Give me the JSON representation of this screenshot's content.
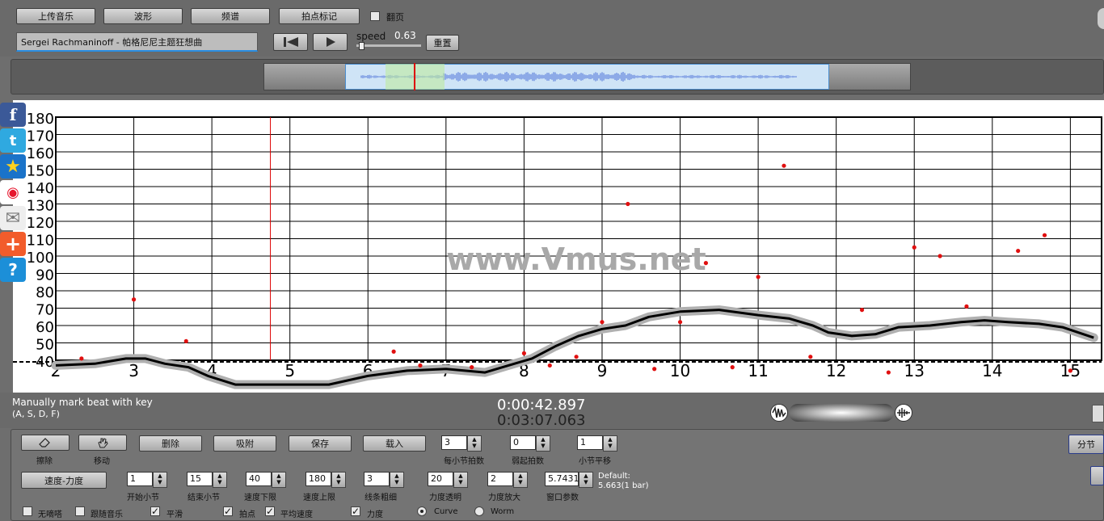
{
  "toolbar": {
    "upload_label": "上传音乐",
    "waveform_label": "波形",
    "spectrum_label": "频谱",
    "beat_label": "拍点标记",
    "page_turn_label": "翻页",
    "page_turn_checked": false
  },
  "player": {
    "song_title": "Sergei Rachmaninoff - 帕格尼尼主题狂想曲",
    "speed_label": "speed",
    "speed_value": "0.63",
    "reset_label": "重置"
  },
  "chart_data": {
    "type": "scatter",
    "xlim": [
      2,
      15.4
    ],
    "ylim": [
      40,
      180
    ],
    "x_ticks": [
      2,
      3,
      4,
      5,
      6,
      7,
      8,
      9,
      10,
      11,
      12,
      13,
      14,
      15
    ],
    "y_ticks": [
      40,
      50,
      60,
      70,
      80,
      90,
      100,
      110,
      120,
      130,
      140,
      150,
      160,
      170,
      180
    ],
    "grid": true,
    "watermark": "www.Vmus.net",
    "cursor_x": 4.75,
    "baseline_y": 40,
    "beat_points": [
      {
        "x": 2.33,
        "y": 41
      },
      {
        "x": 3.0,
        "y": 75
      },
      {
        "x": 3.67,
        "y": 51
      },
      {
        "x": 6.33,
        "y": 45
      },
      {
        "x": 6.67,
        "y": 37
      },
      {
        "x": 7.33,
        "y": 36
      },
      {
        "x": 8.0,
        "y": 44
      },
      {
        "x": 8.33,
        "y": 37
      },
      {
        "x": 8.67,
        "y": 42
      },
      {
        "x": 9.0,
        "y": 62
      },
      {
        "x": 9.33,
        "y": 130
      },
      {
        "x": 9.67,
        "y": 35
      },
      {
        "x": 10.0,
        "y": 62
      },
      {
        "x": 10.33,
        "y": 96
      },
      {
        "x": 10.67,
        "y": 36
      },
      {
        "x": 11.0,
        "y": 88
      },
      {
        "x": 11.33,
        "y": 152
      },
      {
        "x": 11.67,
        "y": 42
      },
      {
        "x": 12.33,
        "y": 69
      },
      {
        "x": 12.67,
        "y": 33
      },
      {
        "x": 13.0,
        "y": 105
      },
      {
        "x": 13.33,
        "y": 100
      },
      {
        "x": 13.67,
        "y": 71
      },
      {
        "x": 14.33,
        "y": 103
      },
      {
        "x": 14.67,
        "y": 112
      },
      {
        "x": 15.0,
        "y": 34
      }
    ],
    "curve_series": [
      {
        "x": 2.0,
        "y": 37
      },
      {
        "x": 2.5,
        "y": 38
      },
      {
        "x": 2.9,
        "y": 41
      },
      {
        "x": 3.15,
        "y": 41
      },
      {
        "x": 3.4,
        "y": 38
      },
      {
        "x": 3.7,
        "y": 36
      },
      {
        "x": 3.95,
        "y": 31
      },
      {
        "x": 4.3,
        "y": 26
      },
      {
        "x": 5.5,
        "y": 26
      },
      {
        "x": 6.0,
        "y": 31
      },
      {
        "x": 6.5,
        "y": 34
      },
      {
        "x": 7.0,
        "y": 35
      },
      {
        "x": 7.5,
        "y": 33
      },
      {
        "x": 7.8,
        "y": 37
      },
      {
        "x": 8.1,
        "y": 41
      },
      {
        "x": 8.4,
        "y": 48
      },
      {
        "x": 8.7,
        "y": 54
      },
      {
        "x": 9.0,
        "y": 58
      },
      {
        "x": 9.3,
        "y": 60
      },
      {
        "x": 9.6,
        "y": 65
      },
      {
        "x": 10.0,
        "y": 68
      },
      {
        "x": 10.5,
        "y": 69
      },
      {
        "x": 11.0,
        "y": 66
      },
      {
        "x": 11.4,
        "y": 64
      },
      {
        "x": 11.7,
        "y": 60
      },
      {
        "x": 11.9,
        "y": 56
      },
      {
        "x": 12.2,
        "y": 54
      },
      {
        "x": 12.5,
        "y": 55
      },
      {
        "x": 12.8,
        "y": 59
      },
      {
        "x": 13.2,
        "y": 60
      },
      {
        "x": 13.6,
        "y": 62
      },
      {
        "x": 13.9,
        "y": 63
      },
      {
        "x": 14.2,
        "y": 62
      },
      {
        "x": 14.6,
        "y": 61
      },
      {
        "x": 14.9,
        "y": 59
      },
      {
        "x": 15.3,
        "y": 53
      }
    ]
  },
  "status": {
    "hint_line1": "Manually mark beat with key",
    "hint_line2": "(A, S, D, F)",
    "current_time": "0:00:42.897",
    "total_time": "0:03:07.063"
  },
  "tools": {
    "erase_label": "擦除",
    "move_label": "移动",
    "delete_label": "删除",
    "snap_label": "吸附",
    "save_label": "保存",
    "load_label": "载入",
    "tempo_dynamics_label": "速度-力度",
    "split_label": "分节"
  },
  "params": {
    "beats_per_bar": {
      "label": "每小节拍数",
      "value": "3"
    },
    "pickup_beats": {
      "label": "弱起拍数",
      "value": "0"
    },
    "bar_offset": {
      "label": "小节平移",
      "value": "1"
    },
    "start_bar": {
      "label": "开始小节",
      "value": "1"
    },
    "end_bar": {
      "label": "结束小节",
      "value": "15"
    },
    "tempo_min": {
      "label": "速度下限",
      "value": "40"
    },
    "tempo_max": {
      "label": "速度上限",
      "value": "180"
    },
    "line_width": {
      "label": "线条粗细",
      "value": "3"
    },
    "dyn_transparency": {
      "label": "力度透明",
      "value": "20"
    },
    "dyn_zoom": {
      "label": "力度放大",
      "value": "2"
    },
    "window_param": {
      "label": "窗口参数",
      "value": "5.7431"
    },
    "default_line1": "Default:",
    "default_line2": "5.663(1 bar)"
  },
  "options": {
    "no_tick": {
      "label": "无嘀嗒",
      "checked": false
    },
    "follow_music": {
      "label": "跟随音乐",
      "checked": false
    },
    "smooth": {
      "label": "平滑",
      "checked": true
    },
    "beats": {
      "label": "拍点",
      "checked": true
    },
    "avg_tempo": {
      "label": "平均速度",
      "checked": true
    },
    "dynamics": {
      "label": "力度",
      "checked": true
    },
    "curve": {
      "label": "Curve",
      "selected": true
    },
    "worm": {
      "label": "Worm",
      "selected": false
    }
  },
  "colors": {
    "beat_point": "#e01010",
    "curve": "#000000",
    "curve_band": "#b0b0b0",
    "cursor": "#dd0000",
    "watermark": "#a8a8a8"
  }
}
